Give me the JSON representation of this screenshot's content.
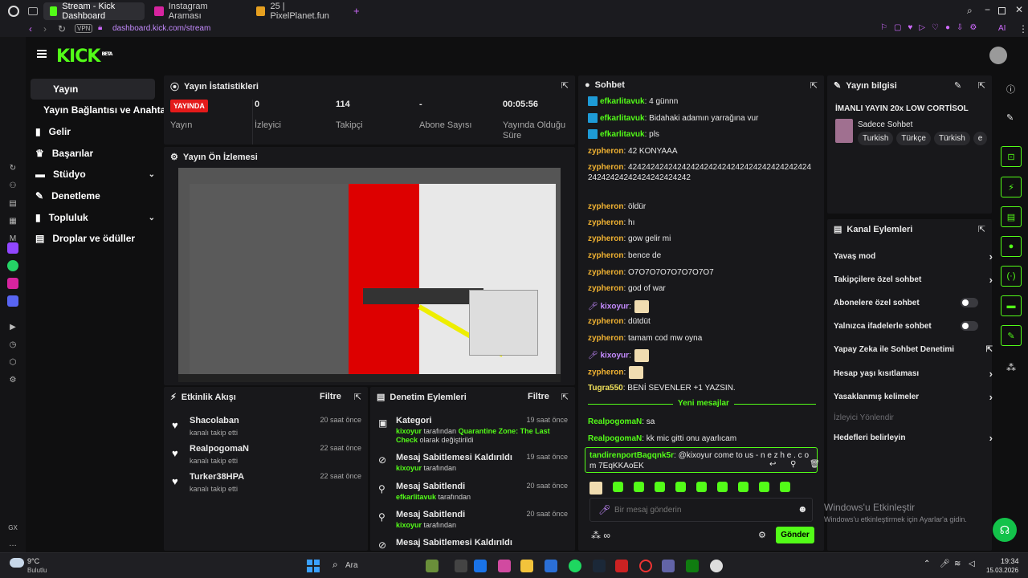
{
  "browser": {
    "tabs": [
      {
        "label": "Stream - Kick Dashboard",
        "active": true
      },
      {
        "label": "Instagram Araması",
        "active": false
      },
      {
        "label": "25 | PixelPlanet.fun",
        "active": false
      }
    ],
    "vpn": "VPN",
    "url": "dashboard.kick.com/stream",
    "ai_label": "AI"
  },
  "nav": {
    "items": [
      {
        "label": "Yayın"
      },
      {
        "label": "Yayın Bağlantısı ve Anahtarı"
      },
      {
        "label": "Gelir"
      },
      {
        "label": "Başarılar"
      },
      {
        "label": "Stüdyo"
      },
      {
        "label": "Denetleme"
      },
      {
        "label": "Topluluk"
      },
      {
        "label": "Droplar ve ödüller"
      }
    ]
  },
  "stats": {
    "title": "Yayın İstatistikleri",
    "live_badge": "YAYINDA",
    "cols": [
      {
        "value": "",
        "label": "Yayın"
      },
      {
        "value": "0",
        "label": "İzleyici"
      },
      {
        "value": "114",
        "label": "Takipçi"
      },
      {
        "value": "-",
        "label": "Abone Sayısı"
      },
      {
        "value": "00:05:56",
        "label": "Yayında Olduğu Süre"
      }
    ]
  },
  "preview": {
    "title": "Yayın Ön İzlemesi"
  },
  "activity": {
    "title": "Etkinlik Akışı",
    "filter": "Filtre",
    "items": [
      {
        "name": "Shacolaban",
        "sub": "kanalı takip etti",
        "time": "20 saat önce"
      },
      {
        "name": "RealpogomaN",
        "sub": "kanalı takip etti",
        "time": "22 saat önce"
      },
      {
        "name": "Turker38HPA",
        "sub": "kanalı takip etti",
        "time": "22 saat önce"
      }
    ]
  },
  "moderation": {
    "title": "Denetim Eylemleri",
    "filter": "Filtre",
    "items": [
      {
        "title": "Kategori",
        "user": "kixoyur",
        "mid": " tarafından ",
        "hl": "Quarantine Zone: The Last Check",
        "tail": " olarak değiştirildi",
        "time": "19 saat önce"
      },
      {
        "title": "Mesaj Sabitlemesi Kaldırıldı",
        "user": "kixoyur",
        "mid": " tarafından",
        "hl": "",
        "tail": "",
        "time": "19 saat önce"
      },
      {
        "title": "Mesaj Sabitlendi",
        "user": "efkarlitavuk",
        "mid": " tarafından",
        "hl": "",
        "tail": "",
        "time": "20 saat önce"
      },
      {
        "title": "Mesaj Sabitlendi",
        "user": "kixoyur",
        "mid": " tarafından",
        "hl": "",
        "tail": "",
        "time": "20 saat önce"
      },
      {
        "title": "Mesaj Sabitlemesi Kaldırıldı",
        "user": "",
        "mid": "",
        "hl": "",
        "tail": "",
        "time": ""
      }
    ]
  },
  "chat": {
    "title": "Sohbet",
    "messages": [
      {
        "user": "efkarlitavuk",
        "color": "g",
        "text": ": 4 günnn",
        "badge": true
      },
      {
        "user": "efkarlitavuk",
        "color": "g",
        "text": ": Bidahaki adamın yarrağına vur",
        "badge": true
      },
      {
        "user": "efkarlitavuk",
        "color": "g",
        "text": ": pls",
        "badge": true
      },
      {
        "user": "zypheron",
        "color": "o",
        "text": ": 42 KONYAAA"
      },
      {
        "user": "zypheron",
        "color": "o",
        "text": ": 4242424242424242424242424242424242424242424242424242424242424242"
      },
      {
        "user": "zypheron",
        "color": "o",
        "text": ": öldür"
      },
      {
        "user": "zypheron",
        "color": "o",
        "text": ": hı"
      },
      {
        "user": "zypheron",
        "color": "o",
        "text": ": gow gelir mi"
      },
      {
        "user": "zypheron",
        "color": "o",
        "text": ": bence de"
      },
      {
        "user": "zypheron",
        "color": "o",
        "text": ": O7O7O7O7O7O7O7O7"
      },
      {
        "user": "zypheron",
        "color": "o",
        "text": ": god of war"
      },
      {
        "user": "kixoyur",
        "color": "p",
        "text": ":",
        "emote": true
      },
      {
        "user": "zypheron",
        "color": "o",
        "text": ": dütdüt"
      },
      {
        "user": "zypheron",
        "color": "o",
        "text": ": tamam cod mw oyna"
      },
      {
        "user": "kixoyur",
        "color": "p",
        "text": ":",
        "emote": true
      },
      {
        "user": "zypheron",
        "color": "o",
        "text": ":",
        "emote": true
      },
      {
        "user": "Tugra550",
        "color": "y",
        "text": ": BENİ SEVENLER +1 YAZSIN."
      }
    ],
    "new_messages": "Yeni mesajlar",
    "after": [
      {
        "user": "RealpogomaN",
        "color": "g",
        "text": ": sa"
      },
      {
        "user": "RealpogomaN",
        "color": "g",
        "text": ": kk mic gitti onu ayarlıcam"
      }
    ],
    "highlight": {
      "user": "tandirenportBagqnk5r",
      "text": ": @kixoyur come to us - n e z h e . c o m 7EqKKAoEK"
    },
    "placeholder": "Bir mesaj gönderin",
    "send": "Gönder"
  },
  "info": {
    "title": "Yayın bilgisi",
    "stream_title": "İMANLI YAYIN 20x LOW CORTİSOL",
    "category": "Sadece Sohbet",
    "tags": [
      "Turkish",
      "Türkçe",
      "Türkish",
      "e"
    ]
  },
  "actions": {
    "title": "Kanal Eylemleri",
    "items": [
      {
        "label": "Yavaş mod",
        "kind": "chev"
      },
      {
        "label": "Takipçilere özel sohbet",
        "kind": "chev"
      },
      {
        "label": "Abonelere özel sohbet",
        "kind": "toggle"
      },
      {
        "label": "Yalnızca ifadelerle sohbet",
        "kind": "toggle"
      },
      {
        "label": "Yapay Zeka ile Sohbet Denetimi",
        "kind": "ext"
      },
      {
        "label": "Hesap yaşı kısıtlaması",
        "kind": "chev"
      },
      {
        "label": "Yasaklanmış kelimeler",
        "kind": "chev"
      },
      {
        "label": "İzleyici Yönlendir",
        "kind": "dim"
      },
      {
        "label": "Hedefleri belirleyin",
        "kind": "chev"
      }
    ]
  },
  "watermark": {
    "line1": "Windows'u Etkinleştir",
    "line2": "Windows'u etkinleştirmek için Ayarlar'a gidin."
  },
  "taskbar": {
    "temp": "9°C",
    "weather": "Bulutlu",
    "search": "Ara",
    "time": "19:34",
    "date": "15.03.2026",
    "gx": "GX"
  },
  "colors": {
    "accent": "#53fc18",
    "live": "#e41a1a"
  }
}
